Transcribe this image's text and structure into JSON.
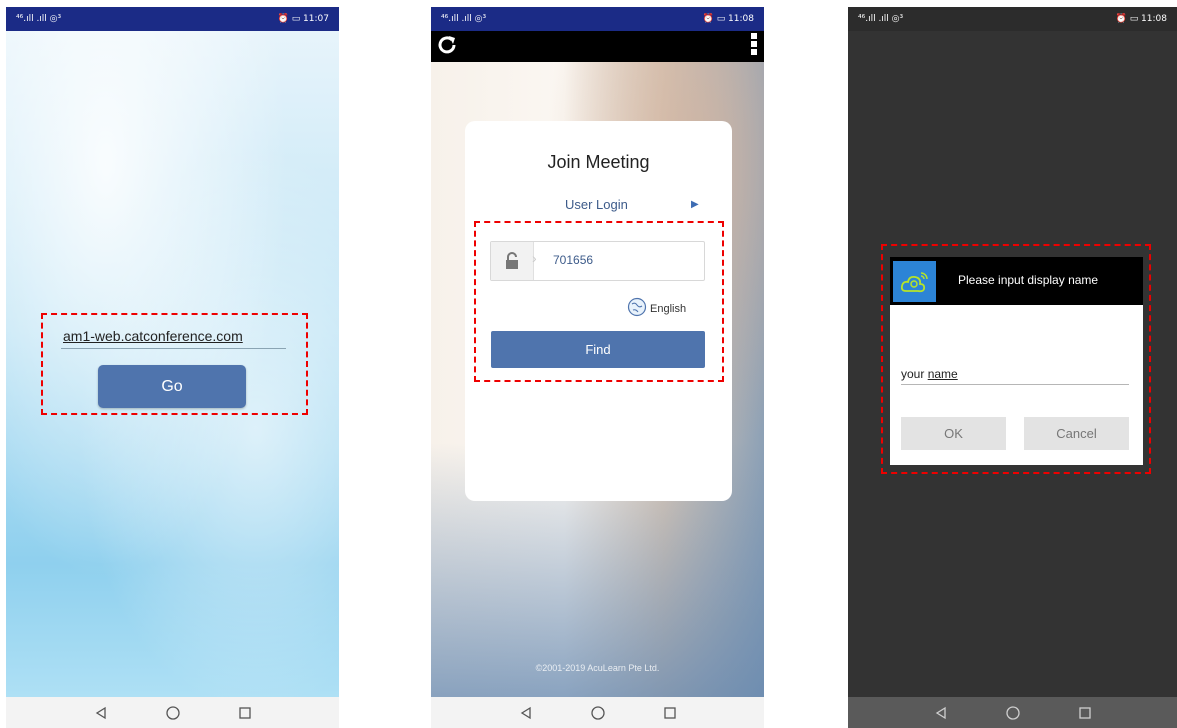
{
  "statusbars": [
    {
      "left": "⁴⁶.ıll .ıll ◎³",
      "right": "⏰ ▭ 11:07"
    },
    {
      "left": "⁴⁶.ıll .ıll ◎³",
      "right": "⏰ ▭ 11:08"
    },
    {
      "left": "⁴⁶.ıll .ıll ◎³",
      "right": "⏰ ▭ 11:08"
    }
  ],
  "screen1": {
    "url_value": "am1-web.catconference.com",
    "go_label": "Go"
  },
  "screen2": {
    "title": "Join Meeting",
    "user_login": "User Login",
    "meeting_code": "701656",
    "language": "English",
    "find_label": "Find",
    "copyright": "©2001-2019 AcuLearn Pte Ltd."
  },
  "screen3": {
    "dialog_title": "Please input display name",
    "name_value_prefix": "your ",
    "name_value_word": "name",
    "ok_label": "OK",
    "cancel_label": "Cancel"
  },
  "colors": {
    "accent_button": "#4f74ad",
    "status_bar": "#1b2b86",
    "highlight_dash": "#ee0000"
  },
  "icons": [
    "refresh-icon",
    "more-vert-icon",
    "lock-icon",
    "globe-icon",
    "back-icon",
    "home-icon",
    "recents-icon",
    "app-logo-icon"
  ]
}
